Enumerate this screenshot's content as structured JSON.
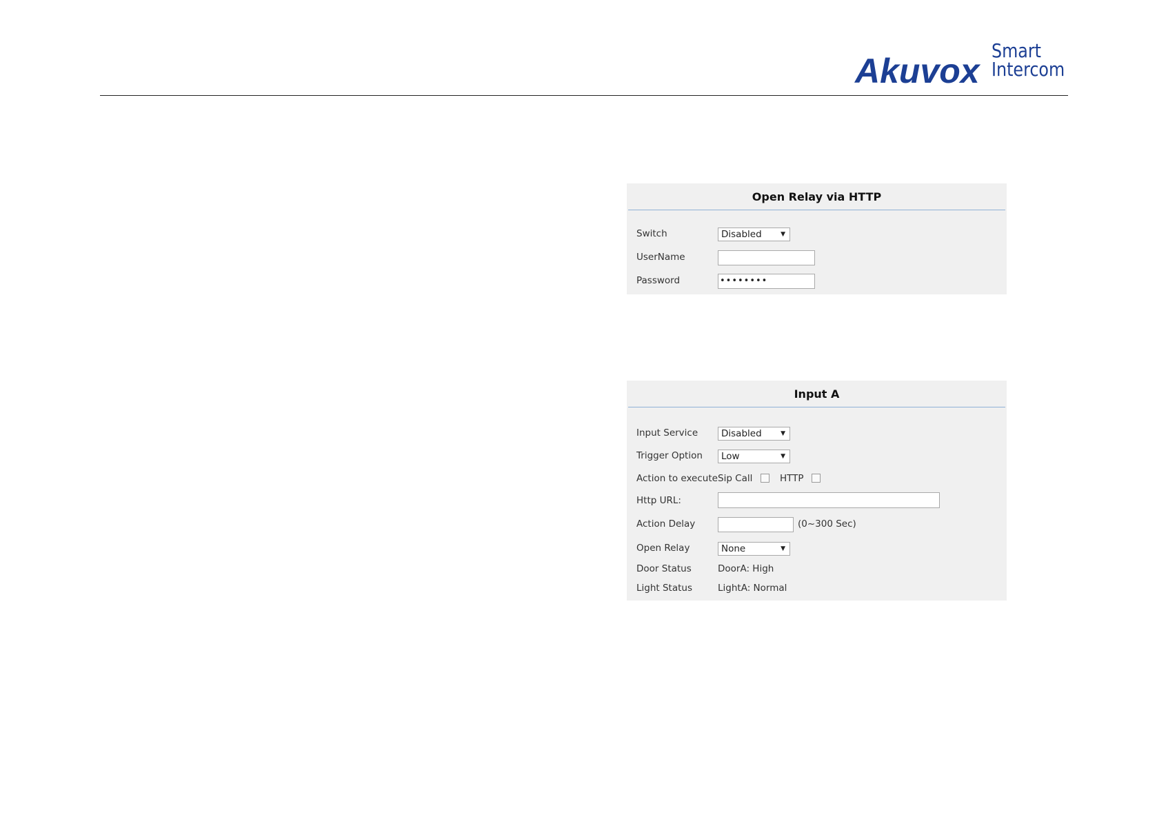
{
  "brand": {
    "logo_main": "Akuvox",
    "logo_sub_line1": "Smart",
    "logo_sub_line2": "Intercom",
    "color": "#1c3f94"
  },
  "relay_panel": {
    "title": "Open Relay via HTTP",
    "switch": {
      "label": "Switch",
      "value": "Disabled"
    },
    "username": {
      "label": "UserName",
      "value": ""
    },
    "password": {
      "label": "Password",
      "value": "••••••••"
    }
  },
  "input_panel": {
    "title": "Input A",
    "input_service": {
      "label": "Input Service",
      "value": "Disabled"
    },
    "trigger_option": {
      "label": "Trigger Option",
      "value": "Low"
    },
    "action_to_execute": {
      "label": "Action to execute",
      "sip_call_label": "Sip Call",
      "http_label": "HTTP"
    },
    "http_url": {
      "label": "Http URL:",
      "value": ""
    },
    "action_delay": {
      "label": "Action Delay",
      "value": "",
      "hint": "(0~300 Sec)"
    },
    "open_relay": {
      "label": "Open Relay",
      "value": "None"
    },
    "door_status": {
      "label": "Door Status",
      "value": "DoorA: High"
    },
    "light_status": {
      "label": "Light Status",
      "value": "LightA: Normal"
    }
  }
}
